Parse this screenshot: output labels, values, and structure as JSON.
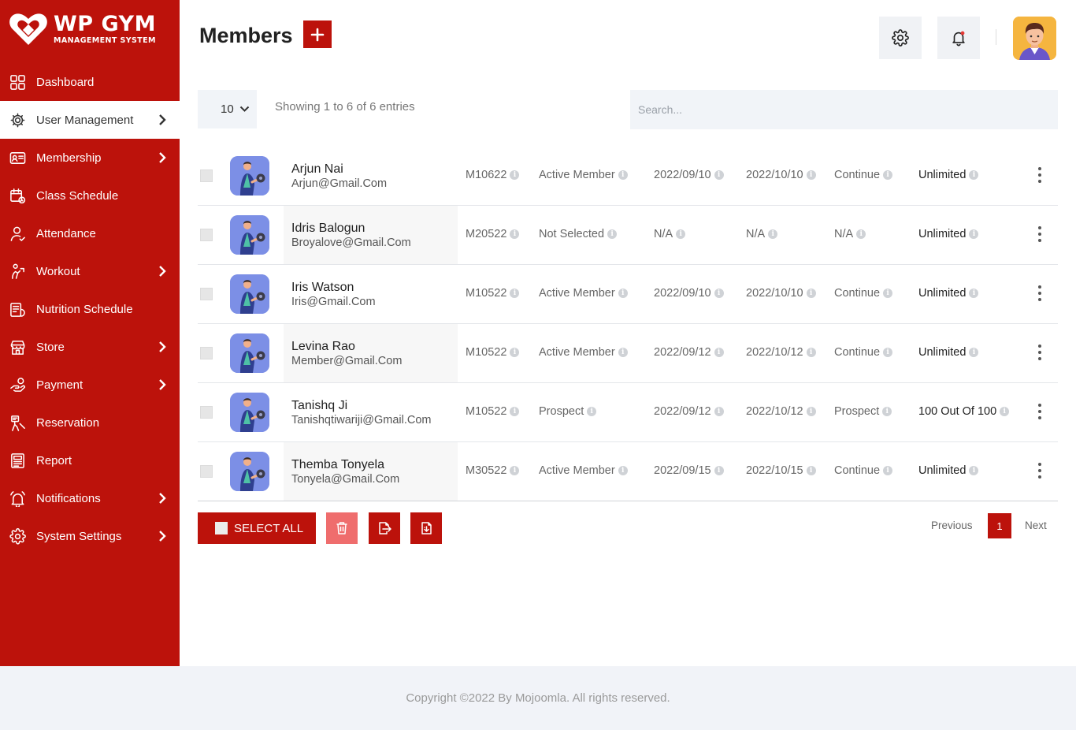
{
  "brand": {
    "title": "WP GYM",
    "subtitle": "MANAGEMENT SYSTEM",
    "color": "#bc120b"
  },
  "sidebar": {
    "items": [
      {
        "label": "Dashboard",
        "icon": "dashboard-grid-icon",
        "has_submenu": false,
        "active": false
      },
      {
        "label": "User Management",
        "icon": "users-gear-icon",
        "has_submenu": true,
        "active": true
      },
      {
        "label": "Membership",
        "icon": "membership-card-icon",
        "has_submenu": true,
        "active": false
      },
      {
        "label": "Class Schedule",
        "icon": "calendar-icon",
        "has_submenu": false,
        "active": false
      },
      {
        "label": "Attendance",
        "icon": "user-check-icon",
        "has_submenu": false,
        "active": false
      },
      {
        "label": "Workout",
        "icon": "workout-icon",
        "has_submenu": true,
        "active": false
      },
      {
        "label": "Nutrition Schedule",
        "icon": "nutrition-icon",
        "has_submenu": false,
        "active": false
      },
      {
        "label": "Store",
        "icon": "store-icon",
        "has_submenu": true,
        "active": false
      },
      {
        "label": "Payment",
        "icon": "payment-icon",
        "has_submenu": true,
        "active": false
      },
      {
        "label": "Reservation",
        "icon": "reservation-icon",
        "has_submenu": false,
        "active": false
      },
      {
        "label": "Report",
        "icon": "report-icon",
        "has_submenu": false,
        "active": false
      },
      {
        "label": "Notifications",
        "icon": "bell-icon",
        "has_submenu": true,
        "active": false
      },
      {
        "label": "System Settings",
        "icon": "gear-icon",
        "has_submenu": true,
        "active": false
      }
    ]
  },
  "header": {
    "title": "Members"
  },
  "controls": {
    "entries_value": "10",
    "showing_text": "Showing 1 to 6 of 6 entries",
    "search_placeholder": "Search..."
  },
  "members": [
    {
      "name": "Arjun Nai",
      "email": "Arjun@Gmail.Com",
      "id": "M10622",
      "type": "Active Member",
      "start": "2022/09/10",
      "end": "2022/10/10",
      "status": "Continue",
      "limit": "Unlimited"
    },
    {
      "name": "Idris Balogun",
      "email": "Broyalove@Gmail.Com",
      "id": "M20522",
      "type": "Not Selected",
      "start": "N/A",
      "end": "N/A",
      "status": "N/A",
      "limit": "Unlimited"
    },
    {
      "name": "Iris Watson",
      "email": "Iris@Gmail.Com",
      "id": "M10522",
      "type": "Active Member",
      "start": "2022/09/10",
      "end": "2022/10/10",
      "status": "Continue",
      "limit": "Unlimited"
    },
    {
      "name": "Levina Rao",
      "email": "Member@Gmail.Com",
      "id": "M10522",
      "type": "Active Member",
      "start": "2022/09/12",
      "end": "2022/10/12",
      "status": "Continue",
      "limit": "Unlimited"
    },
    {
      "name": "Tanishq Ji",
      "email": "Tanishqtiwariji@Gmail.Com",
      "id": "M10522",
      "type": "Prospect",
      "start": "2022/09/12",
      "end": "2022/10/12",
      "status": "Prospect",
      "limit": "100 Out Of 100"
    },
    {
      "name": "Themba Tonyela",
      "email": "Tonyela@Gmail.Com",
      "id": "M30522",
      "type": "Active Member",
      "start": "2022/09/15",
      "end": "2022/10/15",
      "status": "Continue",
      "limit": "Unlimited"
    }
  ],
  "actions": {
    "select_all_label": "SELECT ALL"
  },
  "pagination": {
    "previous": "Previous",
    "current_page": "1",
    "next": "Next"
  },
  "footer": {
    "text": "Copyright ©2022 By Mojoomla. All rights reserved."
  }
}
